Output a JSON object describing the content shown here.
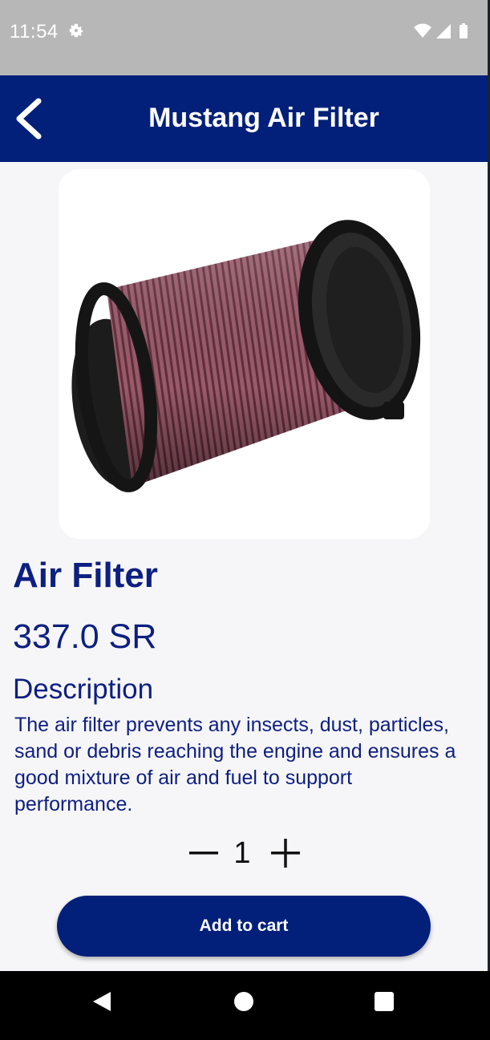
{
  "status_bar": {
    "time": "11:54",
    "icons": [
      "settings-gear-icon",
      "wifi-icon",
      "cellular-signal-icon",
      "battery-icon"
    ]
  },
  "app_bar": {
    "title": "Mustang Air Filter",
    "back_icon": "chevron-left-icon"
  },
  "product": {
    "image": "air-filter-image",
    "name": "Air Filter",
    "price": "337.0 SR",
    "description_heading": "Description",
    "description": "The air filter prevents any insects, dust, particles, sand or debris reaching the engine and ensures a good mixture of air and fuel to support performance."
  },
  "quantity": {
    "value": "1",
    "decrement_icon": "minus-icon",
    "increment_icon": "plus-icon"
  },
  "actions": {
    "add_to_cart_label": "Add to cart"
  },
  "nav_bar": {
    "icons": [
      "nav-back-icon",
      "nav-home-icon",
      "nav-recents-icon"
    ]
  },
  "colors": {
    "primary": "#02207a",
    "text_primary": "#0d1f80",
    "background": "#f6f6f8",
    "status_bar": "#b7b7b7",
    "filter_media": "#8a4d5c",
    "filter_cap": "#1a1a1a"
  }
}
